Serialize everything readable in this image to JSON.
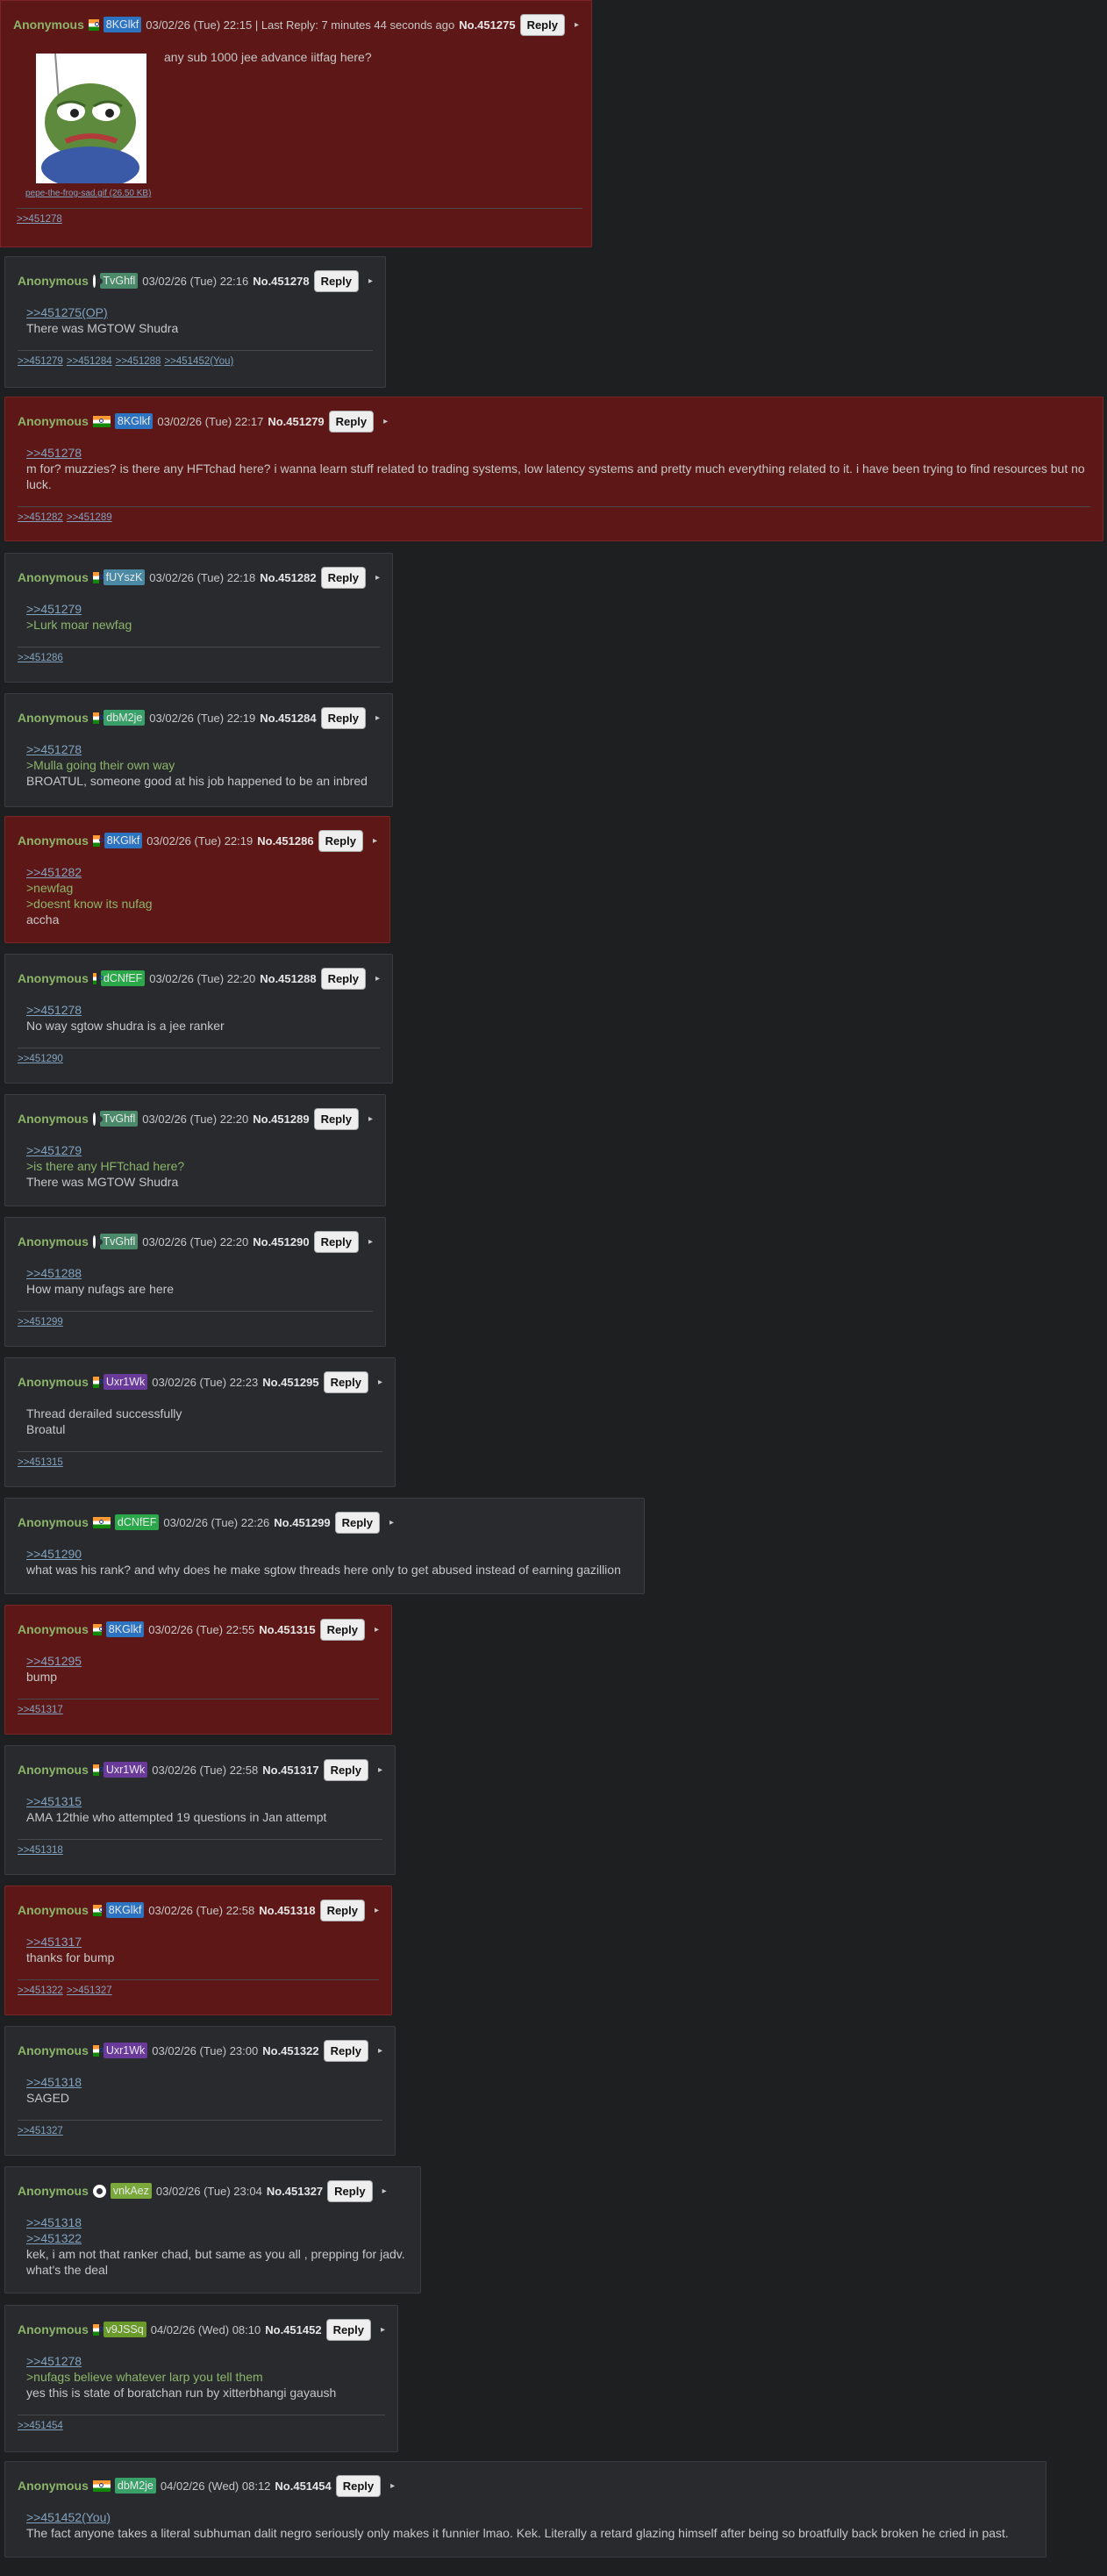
{
  "thread": {
    "op": {
      "name": "Anonymous",
      "date": "03/02/26 (Tue) 22:15 | Last Reply: 7 minutes 44 seconds ago",
      "no": "No.451275",
      "reply_label": "Reply",
      "arrow": "▸",
      "uid": "8KGlkf",
      "uid_color": "#2c74c2",
      "flag": "india-flag",
      "file_name": "pepe-the-frog-sad.gif (26.50 KB)",
      "text": "any sub 1000 jee advance iitfag here?",
      "backlinks": [
        ">>451278"
      ]
    },
    "posts": [
      {
        "name": "Anonymous",
        "flag": "globe",
        "uid": "TvGhfl",
        "uid_color": "#4a8a6a",
        "date": "03/02/26 (Tue) 22:16",
        "no": "No.451278",
        "reply": "Reply",
        "mine": false,
        "lines": [
          {
            "t": "ql",
            "v": ">>451275(OP)"
          },
          {
            "t": "tx",
            "v": "There was MGTOW Shudra"
          }
        ],
        "backlinks": [
          ">>451279",
          ">>451284",
          ">>451288",
          ">>451452(You)"
        ]
      },
      {
        "name": "Anonymous",
        "flag": "india",
        "uid": "8KGlkf",
        "uid_color": "#2c74c2",
        "date": "03/02/26 (Tue) 22:17",
        "no": "No.451279",
        "reply": "Reply",
        "mine": true,
        "lines": [
          {
            "t": "ql",
            "v": ">>451278"
          },
          {
            "t": "tx",
            "v": "m for? muzzies? is there any HFTchad here? i wanna learn stuff related to trading systems, low latency systems and pretty much everything related to it. i have been trying to find resources but no luck."
          }
        ],
        "backlinks": [
          ">>451282",
          ">>451289"
        ]
      },
      {
        "name": "Anonymous",
        "flag": "india",
        "uid": "fUYszK",
        "uid_color": "#4a8aa5",
        "date": "03/02/26 (Tue) 22:18",
        "no": "No.451282",
        "reply": "Reply",
        "mine": false,
        "lines": [
          {
            "t": "ql",
            "v": ">>451279"
          },
          {
            "t": "gt",
            "v": ">Lurk moar newfag"
          }
        ],
        "backlinks": [
          ">>451286"
        ]
      },
      {
        "name": "Anonymous",
        "flag": "india",
        "uid": "dbM2je",
        "uid_color": "#3aa06a",
        "date": "03/02/26 (Tue) 22:19",
        "no": "No.451284",
        "reply": "Reply",
        "mine": false,
        "lines": [
          {
            "t": "ql",
            "v": ">>451278"
          },
          {
            "t": "gt",
            "v": ">Mulla going their own way"
          },
          {
            "t": "tx",
            "v": "BROATUL, someone good at his job happened to be an inbred"
          }
        ],
        "backlinks": []
      },
      {
        "name": "Anonymous",
        "flag": "india",
        "uid": "8KGlkf",
        "uid_color": "#2c74c2",
        "date": "03/02/26 (Tue) 22:19",
        "no": "No.451286",
        "reply": "Reply",
        "mine": true,
        "lines": [
          {
            "t": "ql",
            "v": ">>451282"
          },
          {
            "t": "gt",
            "v": ">newfag"
          },
          {
            "t": "gt",
            "v": ">doesnt know its nufag"
          },
          {
            "t": "tx",
            "v": "accha"
          }
        ],
        "backlinks": []
      },
      {
        "name": "Anonymous",
        "flag": "india",
        "uid": "dCNfEF",
        "uid_color": "#2aa84a",
        "date": "03/02/26 (Tue) 22:20",
        "no": "No.451288",
        "reply": "Reply",
        "mine": false,
        "lines": [
          {
            "t": "ql",
            "v": ">>451278"
          },
          {
            "t": "tx",
            "v": "No way sgtow shudra is a jee ranker"
          }
        ],
        "backlinks": [
          ">>451290"
        ]
      },
      {
        "name": "Anonymous",
        "flag": "globe",
        "uid": "TvGhfl",
        "uid_color": "#4a8a6a",
        "date": "03/02/26 (Tue) 22:20",
        "no": "No.451289",
        "reply": "Reply",
        "mine": false,
        "lines": [
          {
            "t": "ql",
            "v": ">>451279"
          },
          {
            "t": "gt",
            "v": ">is there any HFTchad here?"
          },
          {
            "t": "tx",
            "v": "There was MGTOW Shudra"
          }
        ],
        "backlinks": []
      },
      {
        "name": "Anonymous",
        "flag": "globe",
        "uid": "TvGhfl",
        "uid_color": "#4a8a6a",
        "date": "03/02/26 (Tue) 22:20",
        "no": "No.451290",
        "reply": "Reply",
        "mine": false,
        "lines": [
          {
            "t": "ql",
            "v": ">>451288"
          },
          {
            "t": "tx",
            "v": "How many nufags are here"
          }
        ],
        "backlinks": [
          ">>451299"
        ]
      },
      {
        "name": "Anonymous",
        "flag": "india",
        "uid": "Uxr1Wk",
        "uid_color": "#6a3a9a",
        "date": "03/02/26 (Tue) 22:23",
        "no": "No.451295",
        "reply": "Reply",
        "mine": false,
        "lines": [
          {
            "t": "tx",
            "v": "Thread derailed successfully"
          },
          {
            "t": "tx",
            "v": "Broatul"
          }
        ],
        "backlinks": [
          ">>451315"
        ]
      },
      {
        "name": "Anonymous",
        "flag": "india",
        "uid": "dCNfEF",
        "uid_color": "#2aa84a",
        "date": "03/02/26 (Tue) 22:26",
        "no": "No.451299",
        "reply": "Reply",
        "mine": false,
        "lines": [
          {
            "t": "ql",
            "v": ">>451290"
          },
          {
            "t": "tx",
            "v": "what was his rank? and why does he make sgtow threads here only to get abused instead of earning gazillion"
          }
        ],
        "backlinks": []
      },
      {
        "name": "Anonymous",
        "flag": "india",
        "uid": "8KGlkf",
        "uid_color": "#2c74c2",
        "date": "03/02/26 (Tue) 22:55",
        "no": "No.451315",
        "reply": "Reply",
        "mine": true,
        "lines": [
          {
            "t": "ql",
            "v": ">>451295"
          },
          {
            "t": "tx",
            "v": "bump"
          }
        ],
        "backlinks": [
          ">>451317"
        ]
      },
      {
        "name": "Anonymous",
        "flag": "india",
        "uid": "Uxr1Wk",
        "uid_color": "#6a3a9a",
        "date": "03/02/26 (Tue) 22:58",
        "no": "No.451317",
        "reply": "Reply",
        "mine": false,
        "lines": [
          {
            "t": "ql",
            "v": ">>451315"
          },
          {
            "t": "tx",
            "v": "AMA 12thie who attempted 19 questions in Jan attempt"
          }
        ],
        "backlinks": [
          ">>451318"
        ]
      },
      {
        "name": "Anonymous",
        "flag": "india",
        "uid": "8KGlkf",
        "uid_color": "#2c74c2",
        "date": "03/02/26 (Tue) 22:58",
        "no": "No.451318",
        "reply": "Reply",
        "mine": true,
        "lines": [
          {
            "t": "ql",
            "v": ">>451317"
          },
          {
            "t": "tx",
            "v": "thanks for bump"
          }
        ],
        "backlinks": [
          ">>451322",
          ">>451327"
        ]
      },
      {
        "name": "Anonymous",
        "flag": "india",
        "uid": "Uxr1Wk",
        "uid_color": "#6a3a9a",
        "date": "03/02/26 (Tue) 23:00",
        "no": "No.451322",
        "reply": "Reply",
        "mine": false,
        "lines": [
          {
            "t": "ql",
            "v": ">>451318"
          },
          {
            "t": "tx",
            "v": "SAGED"
          }
        ],
        "backlinks": [
          ">>451327"
        ]
      },
      {
        "name": "Anonymous",
        "flag": "globe",
        "uid": "vnkAez",
        "uid_color": "#7aa83a",
        "date": "03/02/26 (Tue) 23:04",
        "no": "No.451327",
        "reply": "Reply",
        "mine": false,
        "lines": [
          {
            "t": "ql",
            "v": ">>451318"
          },
          {
            "t": "ql",
            "v": ">>451322"
          },
          {
            "t": "tx",
            "v": "kek, i am not that ranker chad, but same as you all , prepping for jadv."
          },
          {
            "t": "tx",
            "v": "what's the deal"
          }
        ],
        "backlinks": []
      },
      {
        "name": "Anonymous",
        "flag": "india",
        "uid": "v9JSSq",
        "uid_color": "#6a9a2a",
        "date": "04/02/26 (Wed) 08:10",
        "no": "No.451452",
        "reply": "Reply",
        "mine": false,
        "lines": [
          {
            "t": "ql",
            "v": ">>451278"
          },
          {
            "t": "gt",
            "v": ">nufags believe whatever larp you tell them"
          },
          {
            "t": "tx",
            "v": "yes this is state of boratchan run by xitterbhangi gayaush"
          }
        ],
        "backlinks": [
          ">>451454"
        ]
      },
      {
        "name": "Anonymous",
        "flag": "india",
        "uid": "dbM2je",
        "uid_color": "#3aa06a",
        "date": "04/02/26 (Wed) 08:12",
        "no": "No.451454",
        "reply": "Reply",
        "mine": false,
        "lines": [
          {
            "t": "ql",
            "v": ">>451452(You)"
          },
          {
            "t": "tx",
            "v": "The fact anyone takes a literal subhuman dalit negro seriously only makes it funnier lmao. Kek. Literally a retard glazing himself after being so broatfully back broken he cried in past."
          }
        ],
        "backlinks": []
      }
    ]
  }
}
